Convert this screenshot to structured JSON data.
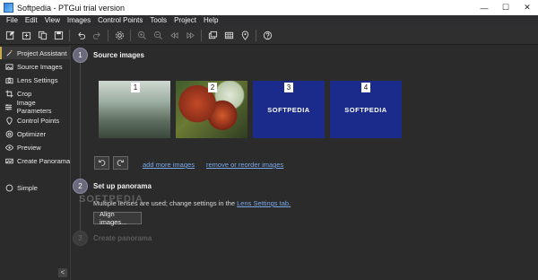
{
  "window": {
    "title": "Softpedia - PTGui trial version",
    "minimize": "—",
    "maximize": "☐",
    "close": "✕"
  },
  "menu": [
    "File",
    "Edit",
    "View",
    "Images",
    "Control Points",
    "Tools",
    "Project",
    "Help"
  ],
  "toolbar": {
    "icons": [
      "new-project-icon",
      "open-project-icon",
      "copy-icon",
      "save-icon",
      "undo-icon",
      "redo-icon",
      "settings-icon",
      "zoom-in-icon",
      "zoom-out-icon",
      "rewind-icon",
      "forward-icon",
      "panorama-editor-icon",
      "table-icon",
      "location-pin-icon",
      "help-icon"
    ]
  },
  "sidebar": {
    "items": [
      {
        "label": "Project Assistant",
        "icon": "magic-wand-icon",
        "active": true
      },
      {
        "label": "Source Images",
        "icon": "image-icon",
        "active": false
      },
      {
        "label": "Lens Settings",
        "icon": "camera-icon",
        "active": false
      },
      {
        "label": "Crop",
        "icon": "crop-icon",
        "active": false
      },
      {
        "label": "Image Parameters",
        "icon": "sliders-icon",
        "active": false
      },
      {
        "label": "Control Points",
        "icon": "pin-icon",
        "active": false
      },
      {
        "label": "Optimizer",
        "icon": "target-icon",
        "active": false
      },
      {
        "label": "Preview",
        "icon": "eye-icon",
        "active": false
      },
      {
        "label": "Create Panorama",
        "icon": "panorama-icon",
        "active": false
      },
      {
        "label": "Simple",
        "icon": "circle-icon",
        "active": false
      }
    ],
    "collapse": "<"
  },
  "steps": [
    {
      "number": "1",
      "title": "Source images"
    },
    {
      "number": "2",
      "title": "Set up panorama"
    },
    {
      "number": "3",
      "title": "Create panorama"
    }
  ],
  "images": [
    {
      "number": "1",
      "type": "forest"
    },
    {
      "number": "2",
      "type": "leaves"
    },
    {
      "number": "3",
      "type": "softpedia",
      "text": "SOFTPEDIA"
    },
    {
      "number": "4",
      "type": "softpedia",
      "text": "SOFTPEDIA"
    }
  ],
  "actions": {
    "add_more": "add more images",
    "remove_reorder": "remove or reorder images",
    "align": "Align images..."
  },
  "setup": {
    "info_prefix": "Multiple lenses are used; change settings in the",
    "info_link": "Lens Settings tab."
  },
  "watermark": "SOFTPEDIA",
  "colors": {
    "accent": "#c9a94e",
    "link": "#7aa7e8",
    "softpedia_bg": "#1a2b8c"
  }
}
